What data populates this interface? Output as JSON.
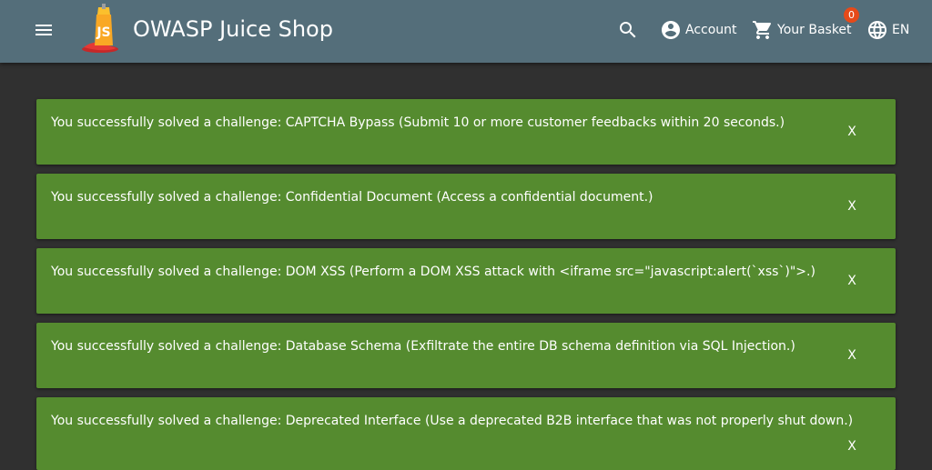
{
  "header": {
    "title": "OWASP Juice Shop",
    "account_label": "Account",
    "basket_label": "Your Basket",
    "basket_count": "0",
    "language_label": "EN",
    "icons": [
      "menu-icon",
      "juice-shop-logo",
      "search-icon",
      "account-circle-icon",
      "shopping-cart-icon",
      "language-icon"
    ]
  },
  "notifications": [
    {
      "message": "You successfully solved a challenge: CAPTCHA Bypass (Submit 10 or more customer feedbacks within 20 seconds.)",
      "close_label": "X"
    },
    {
      "message": "You successfully solved a challenge: Confidential Document (Access a confidential document.)",
      "close_label": "X"
    },
    {
      "message": "You successfully solved a challenge: DOM XSS (Perform a DOM XSS attack with <iframe src=\"javascript:alert(`xss`)\">.)",
      "close_label": "X"
    },
    {
      "message": "You successfully solved a challenge: Database Schema (Exfiltrate the entire DB schema definition via SQL Injection.)",
      "close_label": "X"
    },
    {
      "message": "You successfully solved a challenge: Deprecated Interface (Use a deprecated B2B interface that was not properly shut down.)",
      "close_label": "X"
    }
  ],
  "colors": {
    "toolbar": "#546e7a",
    "background": "#303030",
    "notification": "#558b2f",
    "badge": "#e64a19"
  }
}
